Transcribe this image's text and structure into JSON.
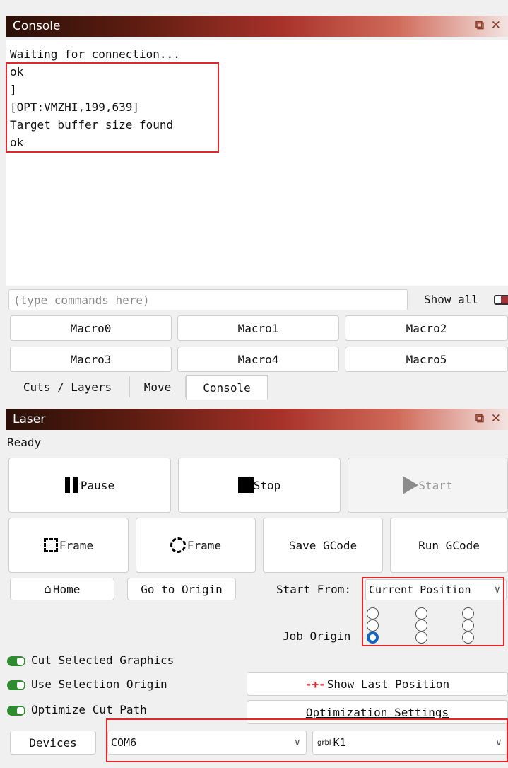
{
  "console_panel": {
    "title": "Console",
    "lines": [
      "Waiting for connection...",
      "ok",
      "]",
      "[OPT:VMZHI,199,639]",
      "Target buffer size found",
      "ok"
    ],
    "command_placeholder": "(type commands here)",
    "show_all_label": "Show all",
    "macros": [
      "Macro0",
      "Macro1",
      "Macro2",
      "Macro3",
      "Macro4",
      "Macro5"
    ]
  },
  "tabs": [
    "Cuts / Layers",
    "Move",
    "Console"
  ],
  "active_tab": "Console",
  "laser_panel": {
    "title": "Laser",
    "status": "Ready",
    "pause_label": "Pause",
    "stop_label": "Stop",
    "start_label": "Start",
    "frame_rect_label": "Frame",
    "frame_circle_label": "Frame",
    "save_gcode_label": "Save GCode",
    "run_gcode_label": "Run GCode",
    "home_label": "Home",
    "go_to_origin_label": "Go to Origin",
    "start_from_label": "Start From:",
    "start_from_value": "Current Position",
    "job_origin_label": "Job Origin",
    "job_origin_selected": "bottom-left",
    "cut_selected_label": "Cut Selected Graphics",
    "use_selection_origin_label": "Use Selection Origin",
    "optimize_cut_path_label": "Optimize Cut Path",
    "show_last_position_label": "Show Last Position",
    "optimization_settings_label": "Optimization Settings",
    "devices_label": "Devices",
    "port_value": "COM6",
    "device_badge": "grbl",
    "device_value": "K1"
  },
  "colors": {
    "highlight": "#e2262a",
    "toggle_on": "#2e8b2e",
    "radio_selected": "#1565c0"
  }
}
